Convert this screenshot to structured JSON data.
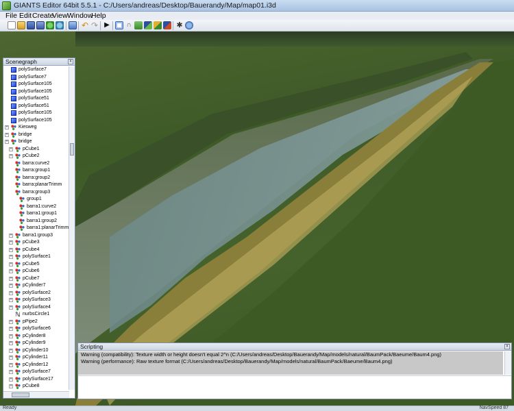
{
  "window": {
    "title": "GIANTS Editor 64bit 5.5.1 - C:/Users/andreas/Desktop/Bauerandy/Map/map01.i3d"
  },
  "menu": {
    "items": [
      "File",
      "Edit",
      "Create",
      "View",
      "Window",
      "Help"
    ]
  },
  "toolbar": {
    "buttons": [
      "new-icon",
      "open-icon",
      "save-icon",
      "save-as-icon",
      "refresh-icon",
      "reload-icon",
      "export-icon",
      "redo-icon",
      "undo-icon",
      "redo-arrow-icon",
      "play-icon",
      "select-icon",
      "magnet-icon",
      "terrain-icon",
      "paint-icon",
      "foliage-icon",
      "paint-bucket-icon",
      "settings-icon",
      "globe-icon"
    ]
  },
  "scenegraph": {
    "title": "Scenegraph",
    "close_label": "x",
    "items": [
      {
        "label": "polySurface7",
        "icon": "cube",
        "depth": 0
      },
      {
        "label": "polySurface7",
        "icon": "cube",
        "depth": 0
      },
      {
        "label": "polySurface105",
        "icon": "cube",
        "depth": 0
      },
      {
        "label": "polySurface105",
        "icon": "cube",
        "depth": 0
      },
      {
        "label": "polySurface51",
        "icon": "cube",
        "depth": 0
      },
      {
        "label": "polySurface51",
        "icon": "cube",
        "depth": 0
      },
      {
        "label": "polySurface105",
        "icon": "cube",
        "depth": 0
      },
      {
        "label": "polySurface105",
        "icon": "cube",
        "depth": 0
      },
      {
        "label": "Kiesweg",
        "icon": "node",
        "depth": 0,
        "expander": true
      },
      {
        "label": "bridge",
        "icon": "node",
        "depth": 0,
        "expander": true
      },
      {
        "label": "bridge",
        "icon": "node",
        "depth": 0,
        "expander": true
      },
      {
        "label": "pCube1",
        "icon": "node",
        "depth": 1,
        "expander": true
      },
      {
        "label": "pCube2",
        "icon": "node",
        "depth": 1,
        "expander": true
      },
      {
        "label": "barra:curve2",
        "icon": "node",
        "depth": 1
      },
      {
        "label": "barra:group1",
        "icon": "node",
        "depth": 1
      },
      {
        "label": "barra:group2",
        "icon": "node",
        "depth": 1
      },
      {
        "label": "barra:planarTrimm",
        "icon": "node",
        "depth": 1
      },
      {
        "label": "barra:group3",
        "icon": "node",
        "depth": 1
      },
      {
        "label": "group1",
        "icon": "node",
        "depth": 2
      },
      {
        "label": "barra1:curve2",
        "icon": "node",
        "depth": 2
      },
      {
        "label": "barra1:group1",
        "icon": "node",
        "depth": 2
      },
      {
        "label": "barra1:group2",
        "icon": "node",
        "depth": 2
      },
      {
        "label": "barra1:planarTrimm",
        "icon": "node",
        "depth": 2
      },
      {
        "label": "barra1:group3",
        "icon": "node",
        "depth": 1,
        "expander": true
      },
      {
        "label": "pCube3",
        "icon": "node",
        "depth": 1,
        "expander": true
      },
      {
        "label": "pCube4",
        "icon": "node",
        "depth": 1,
        "expander": true
      },
      {
        "label": "polySurface1",
        "icon": "node",
        "depth": 1,
        "expander": true
      },
      {
        "label": "pCube5",
        "icon": "node",
        "depth": 1,
        "expander": true
      },
      {
        "label": "pCube6",
        "icon": "node",
        "depth": 1,
        "expander": true
      },
      {
        "label": "pCube7",
        "icon": "node",
        "depth": 1,
        "expander": true
      },
      {
        "label": "pCylinder7",
        "icon": "node",
        "depth": 1,
        "expander": true
      },
      {
        "label": "polySurface2",
        "icon": "node",
        "depth": 1,
        "expander": true
      },
      {
        "label": "polySurface3",
        "icon": "node",
        "depth": 1,
        "expander": true
      },
      {
        "label": "polySurface4",
        "icon": "node",
        "depth": 1,
        "expander": true
      },
      {
        "label": "nurbsCircle1",
        "icon": "curve",
        "depth": 1
      },
      {
        "label": "pPipe2",
        "icon": "node",
        "depth": 1,
        "expander": true
      },
      {
        "label": "polySurface6",
        "icon": "node",
        "depth": 1,
        "expander": true
      },
      {
        "label": "pCylinder8",
        "icon": "node",
        "depth": 1,
        "expander": true
      },
      {
        "label": "pCylinder9",
        "icon": "node",
        "depth": 1,
        "expander": true
      },
      {
        "label": "pCylinder10",
        "icon": "node",
        "depth": 1,
        "expander": true
      },
      {
        "label": "pCylinder11",
        "icon": "node",
        "depth": 1,
        "expander": true
      },
      {
        "label": "pCylinder12",
        "icon": "node",
        "depth": 1,
        "expander": true
      },
      {
        "label": "polySurface7",
        "icon": "node",
        "depth": 1,
        "expander": true
      },
      {
        "label": "polySurface17",
        "icon": "node",
        "depth": 1,
        "expander": true
      },
      {
        "label": "pCube8",
        "icon": "node",
        "depth": 1,
        "expander": true
      }
    ]
  },
  "scripting": {
    "title": "Scripting",
    "close_label": "x",
    "lines": [
      "Warning (compatibility): Texture width or height doesn't equal 2^n (C:/Users/andreas/Desktop/Bauerandy/Map/models/natural/BaumPack/Baeume/Baum4.png)",
      "Warning (performance): Raw texture format (C:/Users/andreas/Desktop/Bauerandy/Map/models/natural/BaumPack/Baeume/Baum4.png)"
    ]
  },
  "status": {
    "left": "Ready",
    "right": "NavSpeed 87"
  }
}
